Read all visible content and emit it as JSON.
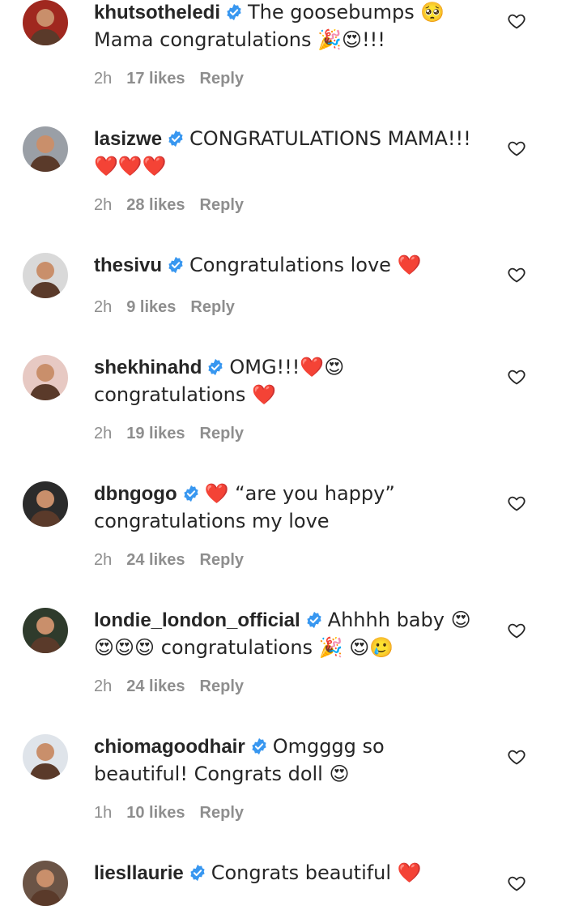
{
  "comments": [
    {
      "username": "khutsotheledi",
      "text": "The goosebumps 🥺 Mama congratulations 🎉😍!!!",
      "time": "2h",
      "likes": "17 likes",
      "reply": "Reply",
      "avatar_color": "#a0281f"
    },
    {
      "username": "lasizwe",
      "text": "CONGRATULATIONS MAMA!!! ❤️❤️❤️",
      "time": "2h",
      "likes": "28 likes",
      "reply": "Reply",
      "avatar_color": "#9a9fa6"
    },
    {
      "username": "thesivu",
      "text": "Congratulations love ❤️",
      "time": "2h",
      "likes": "9 likes",
      "reply": "Reply",
      "avatar_color": "#d9d9d9"
    },
    {
      "username": "shekhinahd",
      "text": "OMG!!!❤️😍congratulations ❤️",
      "time": "2h",
      "likes": "19 likes",
      "reply": "Reply",
      "avatar_color": "#e7c9c3"
    },
    {
      "username": "dbngogo",
      "text": "❤️ “are you happy” congratulations my love",
      "time": "2h",
      "likes": "24 likes",
      "reply": "Reply",
      "avatar_color": "#2b2b2b"
    },
    {
      "username": "londie_london_official",
      "text": "Ahhhh baby 😍😍😍😍 congratulations 🎉 😍🥲",
      "time": "2h",
      "likes": "24 likes",
      "reply": "Reply",
      "avatar_color": "#2f3b2c"
    },
    {
      "username": "chiomagoodhair",
      "text": "Omgggg so beautiful! Congrats doll 😍",
      "time": "1h",
      "likes": "10 likes",
      "reply": "Reply",
      "avatar_color": "#dfe4ea"
    },
    {
      "username": "liesllaurie",
      "text": "Congrats beautiful ❤️",
      "time": "",
      "likes": "",
      "reply": "",
      "avatar_color": "#6b5446"
    }
  ],
  "icons": {
    "verified": "verified-badge-icon",
    "like": "heart-outline-icon"
  },
  "colors": {
    "text": "#262626",
    "meta": "#8e8e8e",
    "verified": "#3897f0"
  }
}
